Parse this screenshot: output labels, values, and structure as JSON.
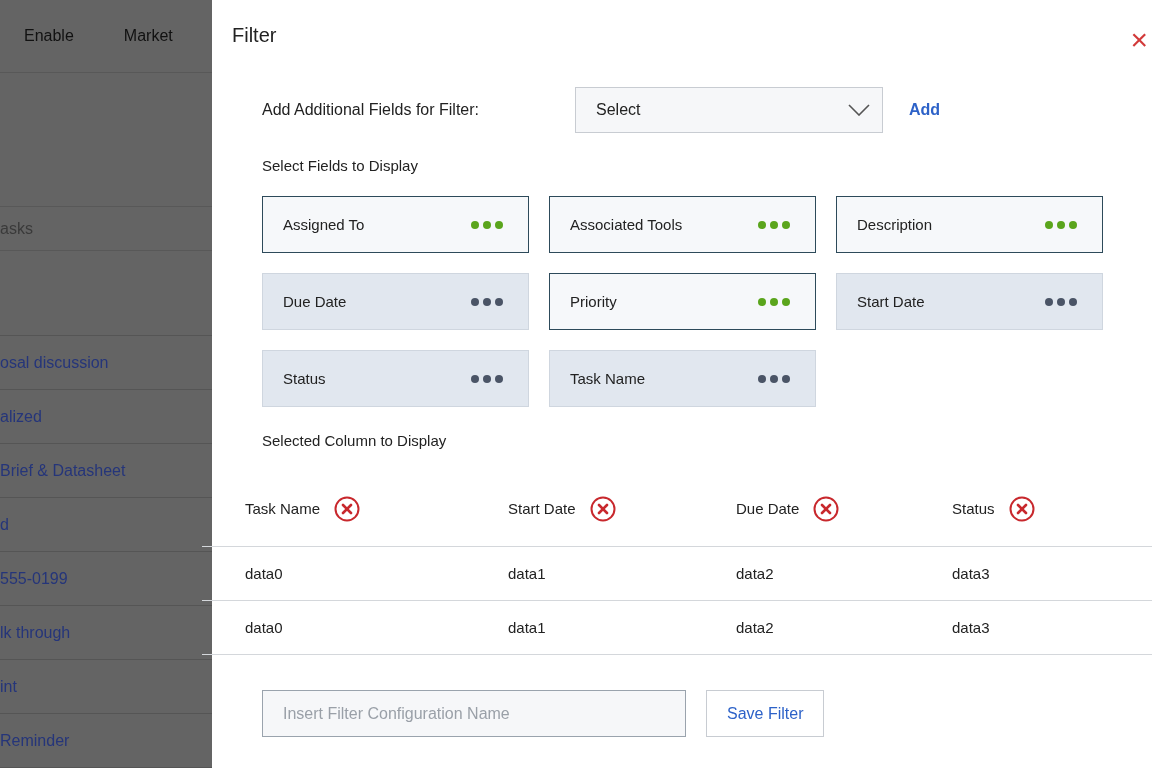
{
  "background_page": {
    "nav": [
      "Enable",
      "Market"
    ],
    "search": {
      "placeholder": "asks"
    },
    "rows": [
      "osal discussion",
      "alized",
      "Brief & Datasheet",
      "d",
      "555-0199",
      "lk through",
      "int",
      "Reminder"
    ]
  },
  "filter_panel": {
    "title": "Filter",
    "close": "×",
    "add_fields": {
      "label": "Add Additional Fields for Filter:",
      "select": "Select",
      "add": "Add"
    },
    "fields_heading": "Select Fields to Display",
    "fields": [
      {
        "label": "Assigned To",
        "selected": true
      },
      {
        "label": "Associated Tools",
        "selected": true
      },
      {
        "label": "Description",
        "selected": true
      },
      {
        "label": "Due Date",
        "selected": false
      },
      {
        "label": "Priority",
        "selected": true
      },
      {
        "label": "Start Date",
        "selected": false
      },
      {
        "label": "Status",
        "selected": false
      },
      {
        "label": "Task Name",
        "selected": false
      }
    ],
    "columns_heading": "Selected Column to Display",
    "table": {
      "columns": [
        "Task Name",
        "Start Date",
        "Due Date",
        "Status"
      ],
      "rows": [
        [
          "data0",
          "data1",
          "data2",
          "data3"
        ],
        [
          "data0",
          "data1",
          "data2",
          "data3"
        ]
      ]
    },
    "config_name": {
      "placeholder": "Insert Filter Configuration Name"
    },
    "save": "Save Filter"
  }
}
